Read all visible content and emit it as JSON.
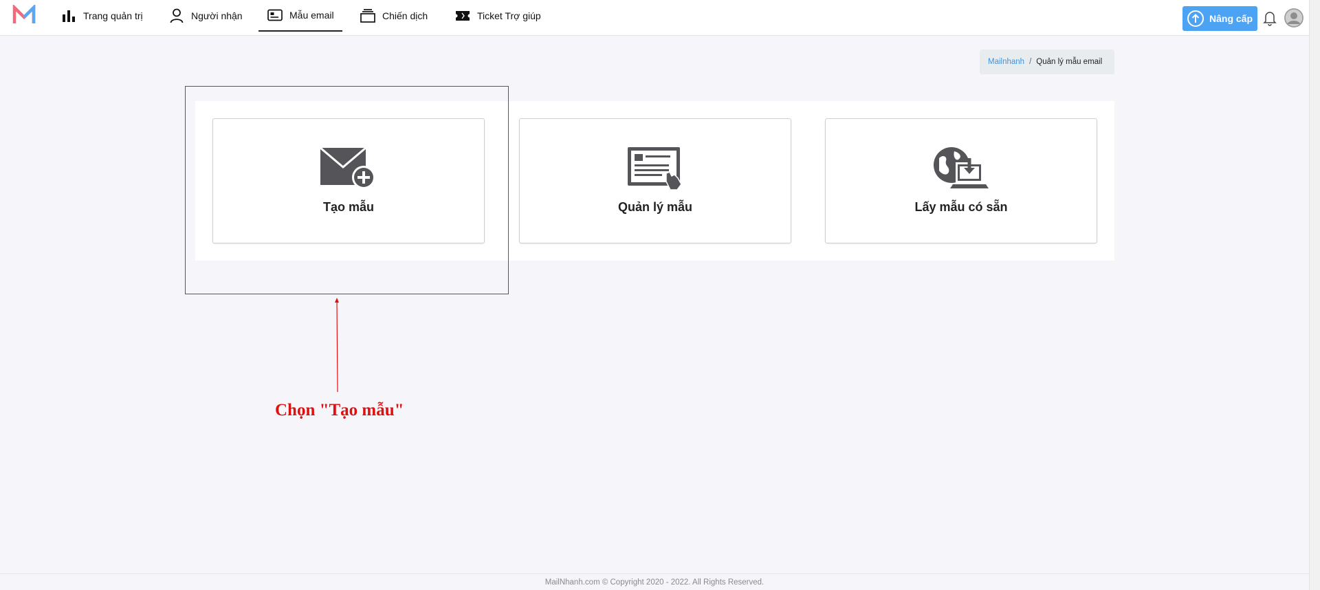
{
  "colors": {
    "accent": "#4da3f3",
    "annotation": "#e01010",
    "logo_pink": "#f26a7a",
    "logo_blue": "#5aa6ef",
    "icon_dark": "#555559"
  },
  "nav": {
    "items": [
      {
        "label": "Trang quản trị",
        "icon": "bar-chart-icon"
      },
      {
        "label": "Người nhận",
        "icon": "user-icon"
      },
      {
        "label": "Mẫu email",
        "icon": "email-template-icon",
        "active": true
      },
      {
        "label": "Chiến dịch",
        "icon": "stack-icon"
      },
      {
        "label": "Ticket Trợ giúp",
        "icon": "ticket-icon"
      }
    ],
    "upgrade_label": "Nâng cấp"
  },
  "breadcrumb": {
    "home": "Mailnhanh",
    "separator": "/",
    "current": "Quản lý mẫu email"
  },
  "cards": [
    {
      "label": "Tạo mẫu",
      "icon": "envelope-plus-icon"
    },
    {
      "label": "Quản lý mẫu",
      "icon": "template-manage-icon"
    },
    {
      "label": "Lấy mẫu có sẵn",
      "icon": "globe-download-icon"
    }
  ],
  "annotation": {
    "text": "Chọn \"Tạo mẫu\""
  },
  "footer": {
    "text": "MailNhanh.com © Copyright 2020 - 2022. All Rights Reserved."
  }
}
